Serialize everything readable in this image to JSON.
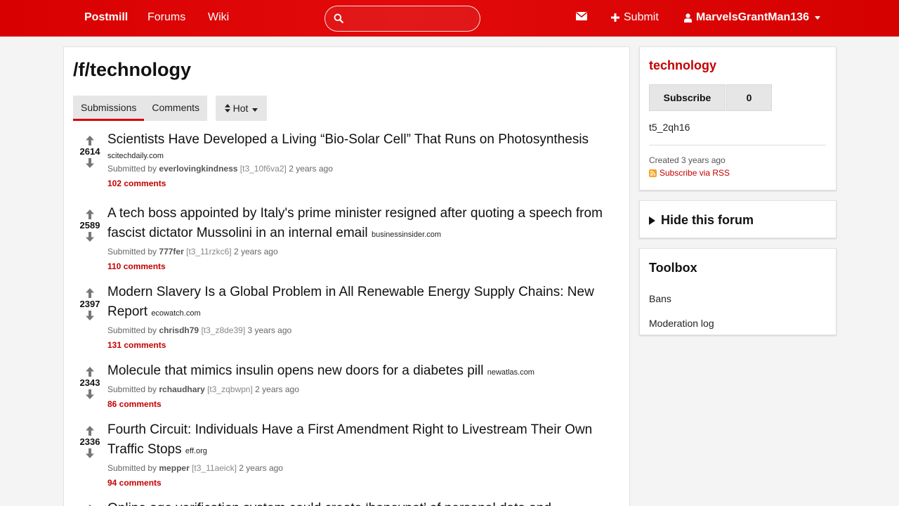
{
  "nav": {
    "brand": "Postmill",
    "links": [
      "Forums",
      "Wiki"
    ],
    "search_value": "",
    "submit_label": "Submit",
    "username": "MarvelsGrantMan136"
  },
  "main": {
    "title": "/f/technology",
    "tabs": [
      "Submissions",
      "Comments"
    ],
    "sort_label": "Hot",
    "submissions": [
      {
        "score": "2614",
        "title": "Scientists Have Developed a Living “Bio-Solar Cell” That Runs on Photosynthesis",
        "domain": "scitechdaily.com",
        "submitted_by": "Submitted by",
        "author": "everlovingkindness",
        "id": "[t3_10f6va2]",
        "age": "2 years ago",
        "comments": "102 comments"
      },
      {
        "score": "2589",
        "title": "A tech boss appointed by Italy's prime minister resigned after quoting a speech from fascist dictator Mussolini in an internal email",
        "domain": "businessinsider.com",
        "submitted_by": "Submitted by",
        "author": "777fer",
        "id": "[t3_11rzkc6]",
        "age": "2 years ago",
        "comments": "110 comments"
      },
      {
        "score": "2397",
        "title": "Modern Slavery Is a Global Problem in All Renewable Energy Supply Chains: New Report",
        "domain": "ecowatch.com",
        "submitted_by": "Submitted by",
        "author": "chrisdh79",
        "id": "[t3_z8de39]",
        "age": "3 years ago",
        "comments": "131 comments"
      },
      {
        "score": "2343",
        "title": "Molecule that mimics insulin opens new doors for a diabetes pill",
        "domain": "newatlas.com",
        "submitted_by": "Submitted by",
        "author": "rchaudhary",
        "id": "[t3_zqbwpn]",
        "age": "2 years ago",
        "comments": "86 comments"
      },
      {
        "score": "2336",
        "title": "Fourth Circuit: Individuals Have a First Amendment Right to Livestream Their Own Traffic Stops",
        "domain": "eff.org",
        "submitted_by": "Submitted by",
        "author": "mepper",
        "id": "[t3_11aeick]",
        "age": "2 years ago",
        "comments": "94 comments"
      },
      {
        "score": "",
        "title": "Online age verification system could create ‘honeypot’ of personal data and",
        "domain": "",
        "submitted_by": "",
        "author": "",
        "id": "",
        "age": "",
        "comments": ""
      }
    ]
  },
  "sidebar": {
    "forum_name": "technology",
    "subscribe_label": "Subscribe",
    "subscriber_count": "0",
    "forum_id": "t5_2qh16",
    "created": "Created 3 years ago",
    "rss_label": "Subscribe via RSS",
    "hide_label": "Hide this forum",
    "toolbox_title": "Toolbox",
    "toolbox_links": [
      "Bans",
      "Moderation log"
    ]
  },
  "colors": {
    "accent": "#d80000",
    "link": "#c40000",
    "rss": "#f5a623"
  },
  "icons": [
    "search-icon",
    "mail-icon",
    "plus-icon",
    "user-icon",
    "caret-down-icon",
    "upvote-icon",
    "downvote-icon",
    "sort-icon",
    "rss-icon",
    "disclosure-triangle-icon"
  ]
}
